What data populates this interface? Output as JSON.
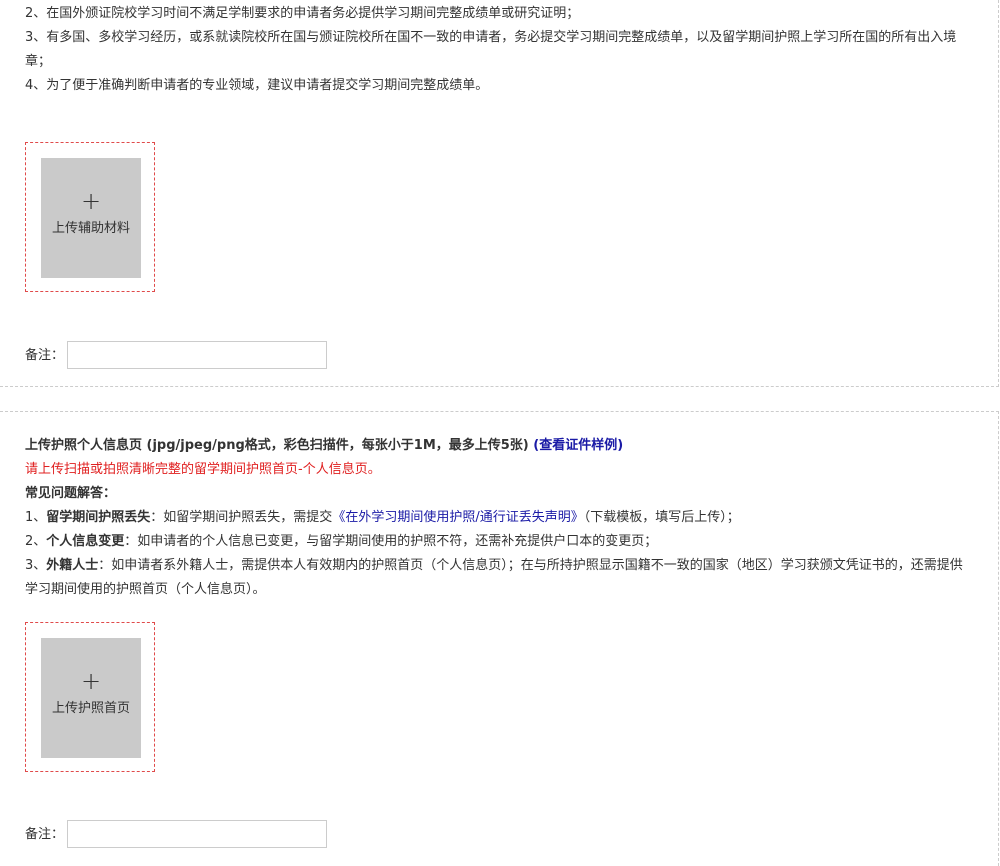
{
  "section1": {
    "notes": [
      "2、在国外颁证院校学习时间不满足学制要求的申请者务必提供学习期间完整成绩单或研究证明；",
      "3、有多国、多校学习经历，或系就读院校所在国与颁证院校所在国不一致的申请者，务必提交学习期间完整成绩单，以及留学期间护照上学习所在国的所有出入境章；",
      "4、为了便于准确判断申请者的专业领域，建议申请者提交学习期间完整成绩单。"
    ],
    "upload_plus": "+",
    "upload_label": "上传辅助材料",
    "remark_label": "备注：",
    "remark_value": ""
  },
  "section2": {
    "title": "上传护照个人信息页 (jpg/jpeg/png格式，彩色扫描件，每张小于1M，最多上传5张)",
    "sample_link": "(查看证件样例)",
    "warning": "请上传扫描或拍照清晰完整的留学期间护照首页-个人信息页。",
    "faq_title": "常见问题解答：",
    "faq": [
      {
        "prefix": "1、",
        "term": "留学期间护照丢失",
        "text_before": "：如留学期间护照丢失，需提交",
        "link": "《在外学习期间使用护照/通行证丢失声明》",
        "text_after": "（下载模板，填写后上传）；"
      },
      {
        "prefix": "2、",
        "term": "个人信息变更",
        "text": "：如申请者的个人信息已变更，与留学期间使用的护照不符，还需补充提供户口本的变更页；"
      },
      {
        "prefix": "3、",
        "term": "外籍人士",
        "text": "：如申请者系外籍人士，需提供本人有效期内的护照首页（个人信息页）；在与所持护照显示国籍不一致的国家（地区）学习获颁文凭证书的，还需提供学习期间使用的护照首页（个人信息页）。"
      }
    ],
    "upload_plus": "+",
    "upload_label": "上传护照首页",
    "remark_label": "备注：",
    "remark_value": ""
  }
}
